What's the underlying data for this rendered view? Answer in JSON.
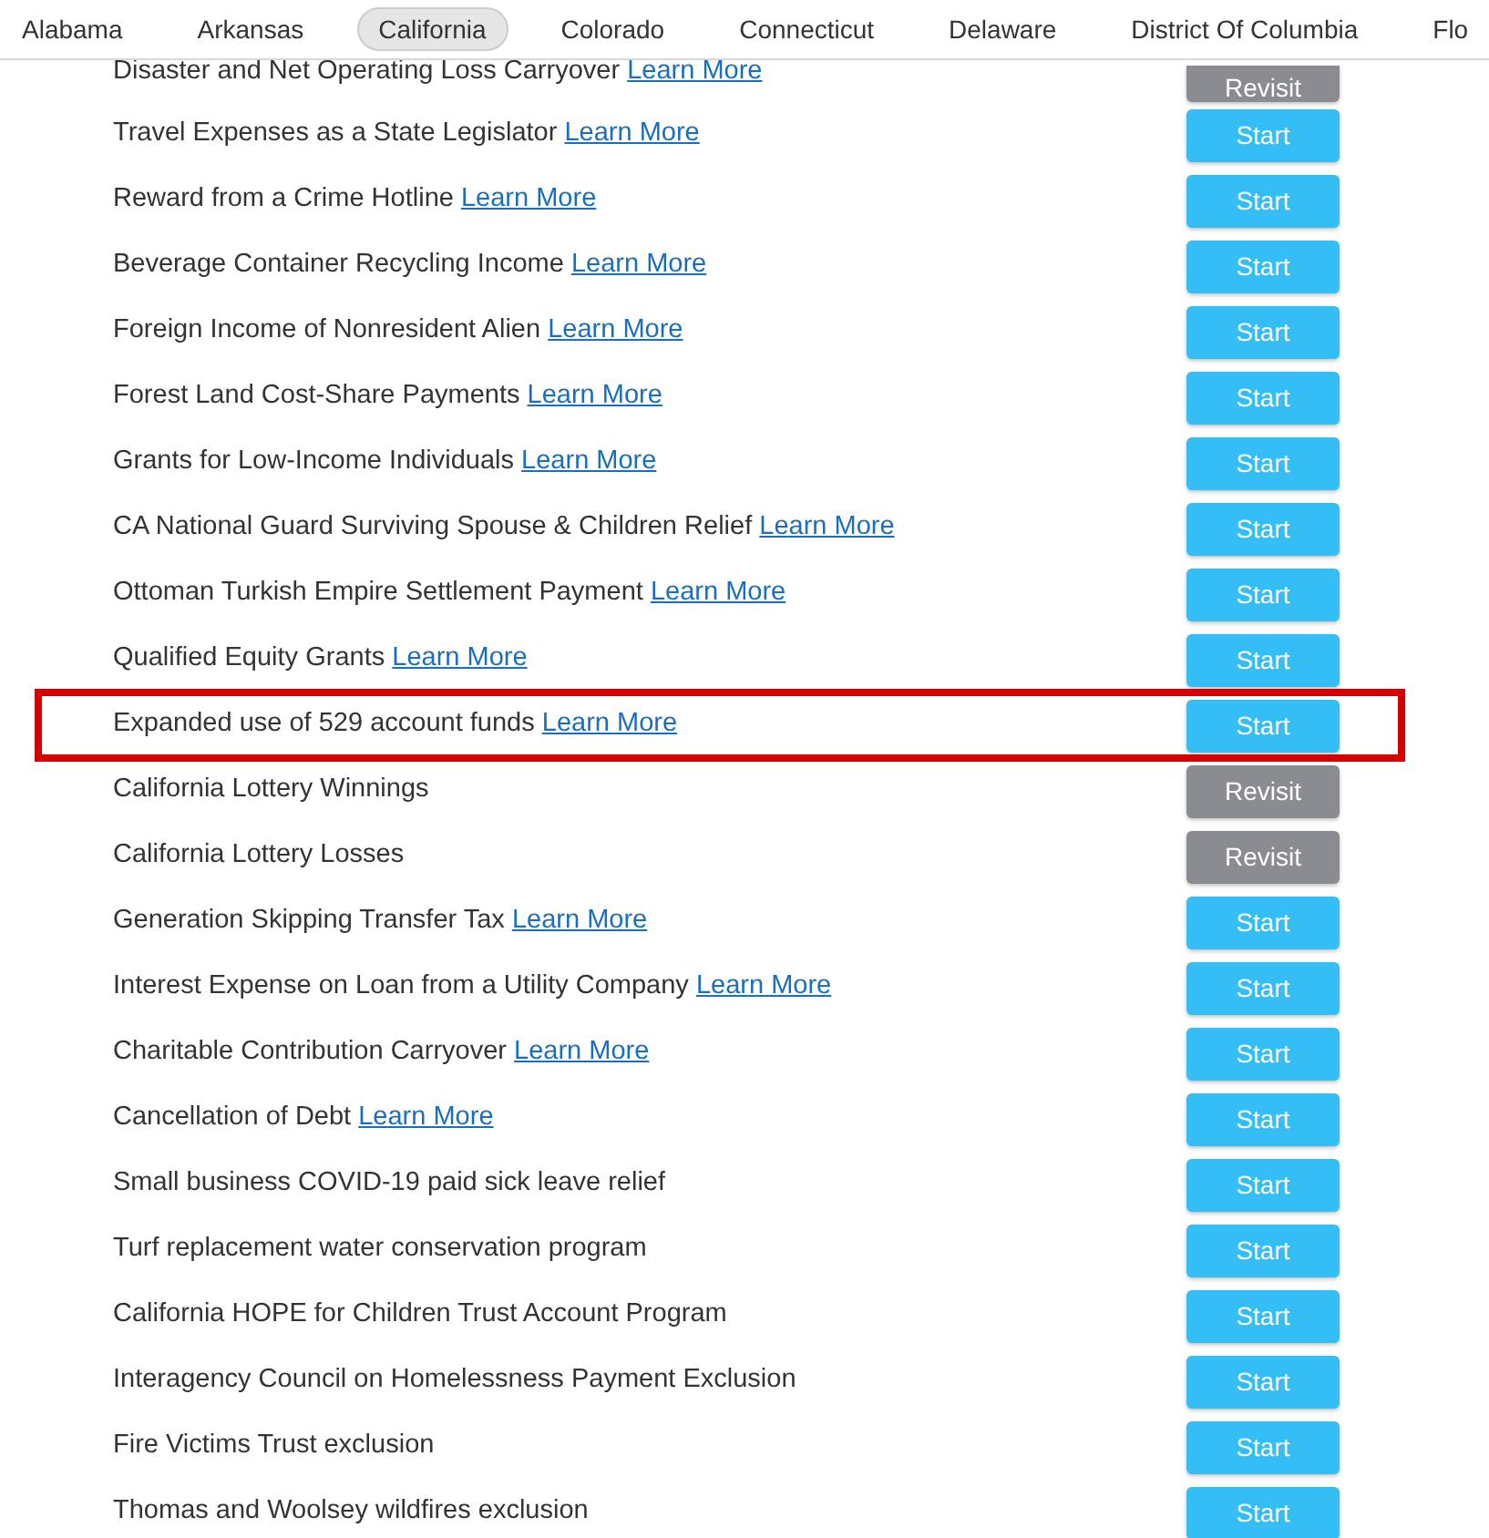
{
  "states": [
    {
      "label": "Alabama",
      "selected": false
    },
    {
      "label": "Arkansas",
      "selected": false
    },
    {
      "label": "California",
      "selected": true
    },
    {
      "label": "Colorado",
      "selected": false
    },
    {
      "label": "Connecticut",
      "selected": false
    },
    {
      "label": "Delaware",
      "selected": false
    },
    {
      "label": "District Of Columbia",
      "selected": false
    },
    {
      "label": "Flo",
      "selected": false
    }
  ],
  "items": [
    {
      "title": "Disaster and Net Operating Loss Carryover",
      "link": "Learn More",
      "button": "Revisit",
      "kind": "revisit",
      "highlighted": false
    },
    {
      "title": "Travel Expenses as a State Legislator",
      "link": "Learn More",
      "button": "Start",
      "kind": "start",
      "highlighted": false
    },
    {
      "title": "Reward from a Crime Hotline",
      "link": "Learn More",
      "button": "Start",
      "kind": "start",
      "highlighted": false
    },
    {
      "title": "Beverage Container Recycling Income",
      "link": "Learn More",
      "button": "Start",
      "kind": "start",
      "highlighted": false
    },
    {
      "title": "Foreign Income of Nonresident Alien",
      "link": "Learn More",
      "button": "Start",
      "kind": "start",
      "highlighted": false
    },
    {
      "title": "Forest Land Cost-Share Payments",
      "link": "Learn More",
      "button": "Start",
      "kind": "start",
      "highlighted": false
    },
    {
      "title": "Grants for Low-Income Individuals",
      "link": "Learn More",
      "button": "Start",
      "kind": "start",
      "highlighted": false
    },
    {
      "title": "CA National Guard Surviving Spouse & Children Relief",
      "link": "Learn More",
      "button": "Start",
      "kind": "start",
      "highlighted": false
    },
    {
      "title": "Ottoman Turkish Empire Settlement Payment",
      "link": "Learn More",
      "button": "Start",
      "kind": "start",
      "highlighted": false
    },
    {
      "title": "Qualified Equity Grants",
      "link": "Learn More",
      "button": "Start",
      "kind": "start",
      "highlighted": false
    },
    {
      "title": "Expanded use of 529 account funds",
      "link": "Learn More",
      "button": "Start",
      "kind": "start",
      "highlighted": true
    },
    {
      "title": "California Lottery Winnings",
      "button": "Revisit",
      "kind": "revisit",
      "highlighted": false
    },
    {
      "title": "California Lottery Losses",
      "button": "Revisit",
      "kind": "revisit",
      "highlighted": false
    },
    {
      "title": "Generation Skipping Transfer Tax",
      "link": "Learn More",
      "button": "Start",
      "kind": "start",
      "highlighted": false
    },
    {
      "title": "Interest Expense on Loan from a Utility Company",
      "link": "Learn More",
      "button": "Start",
      "kind": "start",
      "highlighted": false
    },
    {
      "title": "Charitable Contribution Carryover",
      "link": "Learn More",
      "button": "Start",
      "kind": "start",
      "highlighted": false
    },
    {
      "title": "Cancellation of Debt",
      "link": "Learn More",
      "button": "Start",
      "kind": "start",
      "highlighted": false
    },
    {
      "title": "Small business COVID-19 paid sick leave relief",
      "button": "Start",
      "kind": "start",
      "highlighted": false
    },
    {
      "title": "Turf replacement water conservation program",
      "button": "Start",
      "kind": "start",
      "highlighted": false
    },
    {
      "title": "California HOPE for Children Trust Account Program",
      "button": "Start",
      "kind": "start",
      "highlighted": false
    },
    {
      "title": "Interagency Council on Homelessness Payment Exclusion",
      "button": "Start",
      "kind": "start",
      "highlighted": false
    },
    {
      "title": "Fire Victims Trust exclusion",
      "button": "Start",
      "kind": "start",
      "highlighted": false
    },
    {
      "title": "Thomas and Woolsey wildfires exclusion",
      "button": "Start",
      "kind": "start",
      "highlighted": false
    }
  ]
}
